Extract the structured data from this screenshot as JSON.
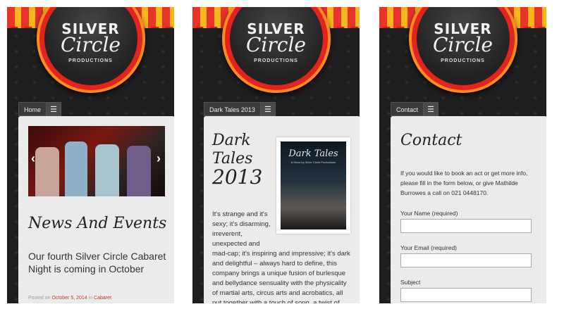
{
  "logo": {
    "line1": "SILVER",
    "line2": "Circle",
    "line3": "PRODUCTIONS"
  },
  "colors": {
    "stripe_red": "#e8322a",
    "stripe_yellow": "#f6b61c",
    "ring": "#e4231c",
    "card": "#ebebeb",
    "link": "#c0392b"
  },
  "icons": {
    "menu": "hamburger-icon",
    "prev": "chevron-left-icon",
    "next": "chevron-right-icon"
  },
  "screen1": {
    "nav_label": "Home",
    "heading": "News And Events",
    "post_title": "Our fourth Silver Circle Cabaret Night is coming in October",
    "meta_prefix": "Posted on",
    "meta_date": "October 5, 2014",
    "meta_in": "in",
    "meta_category": "Cabaret"
  },
  "screen2": {
    "nav_label": "Dark Tales 2013",
    "heading_line1": "Dark Tales",
    "heading_line2": "2013",
    "poster_title": "Dark Tales",
    "poster_sub": "A Show by Silver Circle Productions",
    "side_text": "It's strange and it's sexy; it's disarming, irreverent, unexpected and",
    "body_text": "mad-cap; it's inspiring and impressive; it's dark and delightful – always hard to define, this company brings a unique fusion of burlesque and bellydance sensuality with the physicality of martial arts, circus arts and acrobatics, all put together with a touch of song, a twist of quirky comedy a smidgeon of"
  },
  "screen3": {
    "nav_label": "Contact",
    "heading": "Contact",
    "intro": "If you would like to book an act or get more info, please fill in the form below, or give Mathilde Burrowes a call on 021 0448170.",
    "name_label": "Your Name (required)",
    "email_label": "Your Email (required)",
    "subject_label": "Subject"
  }
}
